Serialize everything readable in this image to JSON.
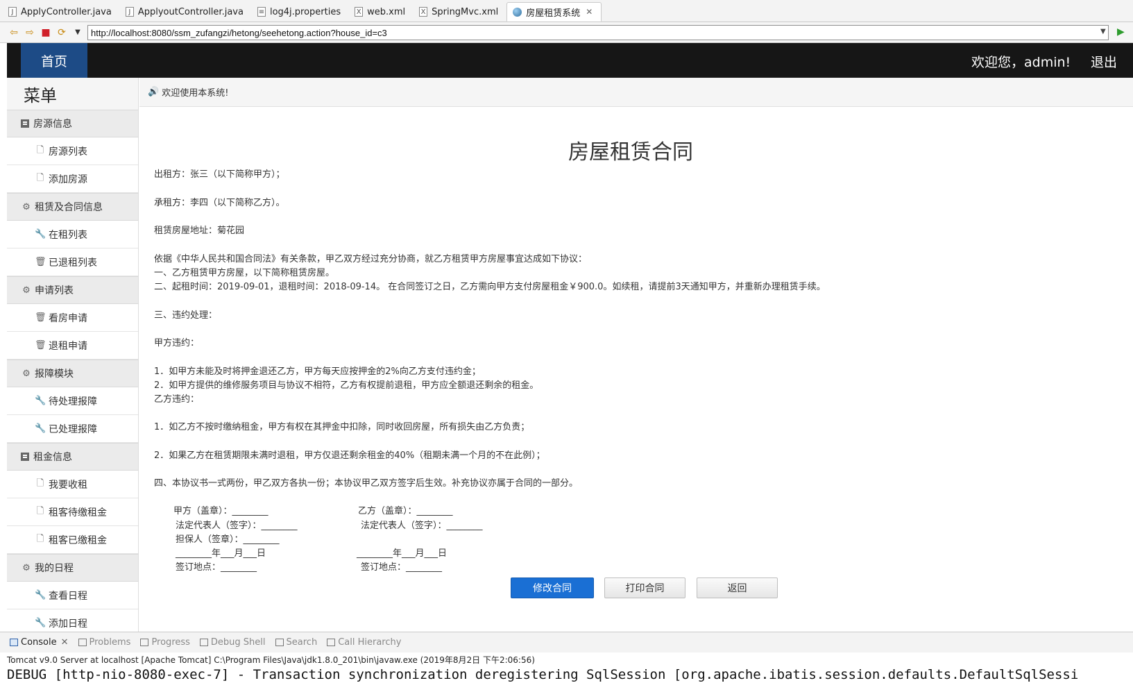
{
  "editor_tabs": [
    {
      "label": "ApplyController.java",
      "icon": "java-file-icon"
    },
    {
      "label": "ApplyoutController.java",
      "icon": "java-file-icon"
    },
    {
      "label": "log4j.properties",
      "icon": "properties-file-icon"
    },
    {
      "label": "web.xml",
      "icon": "xml-file-icon"
    },
    {
      "label": "SpringMvc.xml",
      "icon": "xml-file-icon"
    },
    {
      "label": "房屋租赁系统",
      "icon": "globe-icon",
      "active": true
    }
  ],
  "browser": {
    "url": "http://localhost:8080/ssm_zufangzi/hetong/seehetong.action?house_id=c3"
  },
  "navbar": {
    "home": "首页",
    "welcome": "欢迎您，admin!",
    "logout": "退出"
  },
  "sidebar": {
    "title": "菜单",
    "groups": [
      {
        "label": "房源信息",
        "icon": "list-icon",
        "items": [
          {
            "label": "房源列表",
            "icon": "file-icon"
          },
          {
            "label": "添加房源",
            "icon": "file-icon"
          }
        ]
      },
      {
        "label": "租赁及合同信息",
        "icon": "gear-icon",
        "items": [
          {
            "label": "在租列表",
            "icon": "wrench-icon"
          },
          {
            "label": "已退租列表",
            "icon": "trash-icon"
          }
        ]
      },
      {
        "label": "申请列表",
        "icon": "gear-icon",
        "items": [
          {
            "label": "看房申请",
            "icon": "trash-icon"
          },
          {
            "label": "退租申请",
            "icon": "trash-icon"
          }
        ]
      },
      {
        "label": "报障模块",
        "icon": "gear-icon",
        "items": [
          {
            "label": "待处理报障",
            "icon": "wrench-icon"
          },
          {
            "label": "已处理报障",
            "icon": "wrench-icon"
          }
        ]
      },
      {
        "label": "租金信息",
        "icon": "list-icon",
        "items": [
          {
            "label": "我要收租",
            "icon": "file-icon"
          },
          {
            "label": "租客待缴租金",
            "icon": "file-icon"
          },
          {
            "label": "租客已缴租金",
            "icon": "file-icon"
          }
        ]
      },
      {
        "label": "我的日程",
        "icon": "gear-icon",
        "items": [
          {
            "label": "查看日程",
            "icon": "wrench-icon"
          },
          {
            "label": "添加日程",
            "icon": "wrench-icon"
          }
        ]
      }
    ]
  },
  "notice": "欢迎使用本系统!",
  "contract": {
    "title": "房屋租赁合同",
    "lessor": "出租方：张三（以下简称甲方）；",
    "lessee": "承租方：李四（以下简称乙方）。",
    "address": "租赁房屋地址：菊花园",
    "basis": "依据《中华人民共和国合同法》有关条款，甲乙双方经过充分协商，就乙方租赁甲方房屋事宜达成如下协议：",
    "clause1": "一、乙方租赁甲方房屋，以下简称租赁房屋。",
    "clause2": "二、起租时间：2019-09-01，退租时间：2018-09-14。 在合同签订之日，乙方需向甲方支付房屋租金￥900.0。如续租，请提前3天通知甲方，并重新办理租赁手续。",
    "clause3": "三、违约处理：",
    "party_a_breach": "甲方违约：",
    "a1": "1．如甲方未能及时将押金退还乙方，甲方每天应按押金的2%向乙方支付违约金；",
    "a2": "2．如甲方提供的维修服务项目与协议不相符，乙方有权提前退租，甲方应全额退还剩余的租金。",
    "party_b_breach": "乙方违约：",
    "b1": "1．如乙方不按时缴纳租金，甲方有权在其押金中扣除，同时收回房屋，所有损失由乙方负责；",
    "b2": "2．如果乙方在租赁期限未满时退租，甲方仅退还剩余租金的40%（租期未满一个月的不在此例）；",
    "clause4": "四、本协议书一式两份，甲乙双方各执一份；本协议甲乙双方签字后生效。补充协议亦属于合同的一部分。",
    "sign_a_seal": "甲方（盖章）：________",
    "sign_a_rep": "法定代表人（签字）：________",
    "sign_guarantor": "担保人（签章）：________",
    "sign_a_date": "________年___月___日",
    "sign_a_place": "签订地点：________",
    "sign_b_seal": "乙方（盖章）：________",
    "sign_b_rep": "法定代表人（签字）：________",
    "sign_b_date": "________年___月___日",
    "sign_b_place": "签订地点：________"
  },
  "buttons": {
    "modify": "修改合同",
    "print": "打印合同",
    "back": "返回"
  },
  "console": {
    "tabs": [
      "Console",
      "Problems",
      "Progress",
      "Debug Shell",
      "Search",
      "Call Hierarchy"
    ],
    "server_info": "Tomcat v9.0 Server at localhost [Apache Tomcat] C:\\Program Files\\Java\\jdk1.8.0_201\\bin\\javaw.exe (2019年8月2日 下午2:06:56)",
    "log_line": "DEBUG [http-nio-8080-exec-7] - Transaction synchronization deregistering SqlSession [org.apache.ibatis.session.defaults.DefaultSqlSessi"
  }
}
